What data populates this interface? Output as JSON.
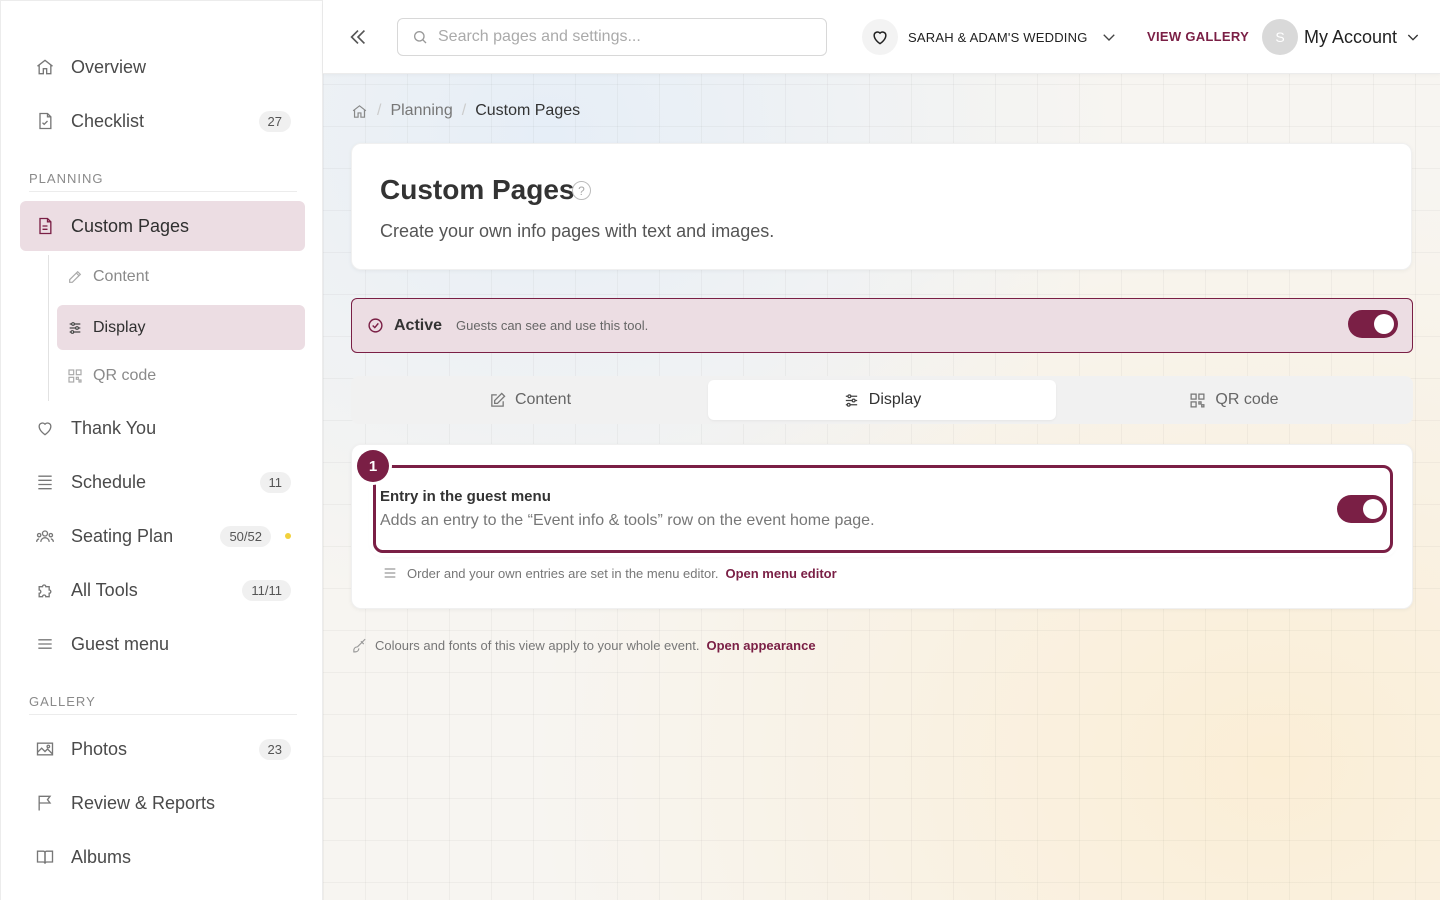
{
  "colors": {
    "accent": "#7a1f45",
    "active_bg": "#ecdde3"
  },
  "sidebar": {
    "items": [
      {
        "label": "Overview",
        "icon": "home-icon"
      },
      {
        "label": "Checklist",
        "badge": "27",
        "icon": "checklist-icon"
      }
    ],
    "planning_label": "PLANNING",
    "custom_pages": {
      "label": "Custom Pages",
      "icon": "document-icon"
    },
    "sub_items": [
      {
        "label": "Content",
        "icon": "edit-icon"
      },
      {
        "label": "Display",
        "icon": "sliders-icon"
      },
      {
        "label": "QR code",
        "icon": "qr-code-icon"
      }
    ],
    "planning_items": [
      {
        "label": "Thank You",
        "icon": "heart-icon"
      },
      {
        "label": "Schedule",
        "badge": "11",
        "icon": "list-icon"
      },
      {
        "label": "Seating Plan",
        "badge": "50/52",
        "icon": "people-icon"
      },
      {
        "label": "All Tools",
        "badge": "11/11",
        "icon": "puzzle-icon"
      },
      {
        "label": "Guest menu",
        "icon": "menu-icon"
      }
    ],
    "gallery_label": "GALLERY",
    "gallery_items": [
      {
        "label": "Photos",
        "badge": "23",
        "icon": "image-icon"
      },
      {
        "label": "Review & Reports",
        "icon": "flag-icon"
      },
      {
        "label": "Albums",
        "icon": "book-icon"
      }
    ]
  },
  "topbar": {
    "search_placeholder": "Search pages and settings...",
    "event_name": "SARAH & ADAM'S WEDDING",
    "view_gallery": "VIEW GALLERY",
    "avatar_initial": "S",
    "account_label": "My Account"
  },
  "breadcrumb": {
    "planning": "Planning",
    "current": "Custom Pages"
  },
  "header": {
    "title": "Custom Pages",
    "help": "?",
    "subtitle": "Create your own info pages with text and images."
  },
  "status": {
    "state": "Active",
    "description": "Guests can see and use this tool.",
    "enabled": true
  },
  "tabs": [
    {
      "label": "Content",
      "icon": "edit-icon"
    },
    {
      "label": "Display",
      "icon": "sliders-icon",
      "active": true
    },
    {
      "label": "QR code",
      "icon": "qr-code-icon"
    }
  ],
  "display": {
    "step": "1",
    "entry_title": "Entry in the guest menu",
    "entry_desc": "Adds an entry to the “Event info & tools” row on the event home page.",
    "entry_enabled": true,
    "menu_note": "Order and your own entries are set in the menu editor.",
    "menu_link": "Open menu editor"
  },
  "appearance": {
    "note": "Colours and fonts of this view apply to your whole event.",
    "link": "Open appearance"
  }
}
